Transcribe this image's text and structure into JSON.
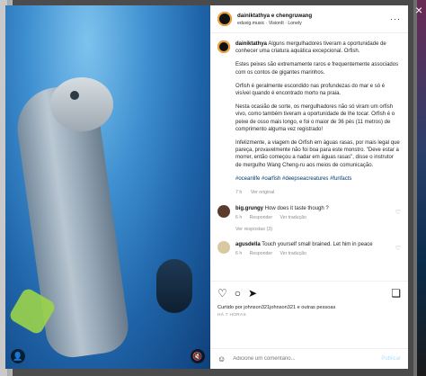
{
  "post": {
    "author": "dainiktathya",
    "header_users": "dainiktathya e chengruwang",
    "audio": "eduvig.music · VisionIt · Lonely",
    "caption_paragraphs": [
      "Alguns mergulhadores tiveram a oportunidade de conhecer uma criatura aquática excepcional. Orfish.",
      "Estes peixes são extremamente raros e frequentemente associados com os contos de gigantes marinhos.",
      "Orfish é geralmente escondido nas profundezas do mar e só é visível quando é encontrado morto na praia.",
      "Nesta ocasião de sorte, os mergulhadores não só viram um orfish vivo, como também tiveram a oportunidade de lhe tocar. Orfish é o peixe de osso mais longo, e foi o maior de 36 pés (11 metros) de comprimento alguma vez registrado!",
      "Infelizmente, a viagem de Orfish em águas rasas, por mais legal que pareça, provavelmente não foi boa para este monstro. \"Deve estar a morrer, então começou a nadar em águas rasas\", disse o instrutor de mergulho Wang Cheng-ru aos meios de comunicação."
    ],
    "hashtags": "#oceanlife #oarfish #deepseacreatures #funfacts",
    "time": "7 h",
    "see_translation": "Ver original",
    "likes": "Curtido por johnson321johnson321 e outras pessoas",
    "date": "HÁ 7 HORAS",
    "add_comment_placeholder": "Adicione um comentário...",
    "publish_label": "Publicar"
  },
  "comments": [
    {
      "user": "big.grungy",
      "text": "How does it taste though ?",
      "time": "6 h",
      "reply": "Responder",
      "translate": "Ver tradução"
    },
    {
      "user": "agusdella",
      "text": "Touch yourself small brained. Let him in peace",
      "time": "6 h",
      "reply": "Responder",
      "translate": "Ver tradução"
    }
  ],
  "replies_label": "Ver respostas (3)",
  "icons": {
    "close": "×",
    "more": "···",
    "heart": "♡",
    "comment": "○",
    "share": "➤",
    "save": "❏",
    "emoji": "☺",
    "user": "👤",
    "mute": "🔇"
  },
  "colors": {
    "link": "#00376b",
    "publish": "#b2dffc",
    "muted": "#8e8e8e"
  }
}
